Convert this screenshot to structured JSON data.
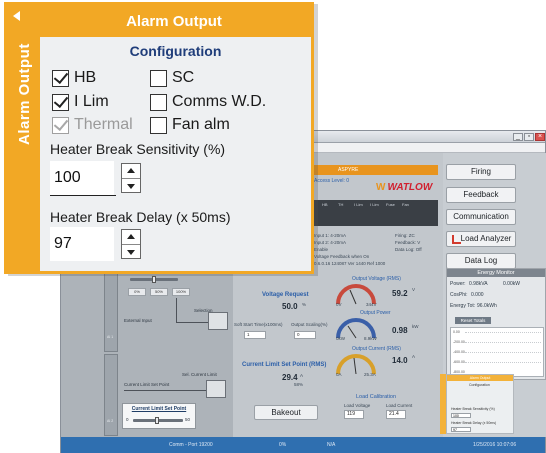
{
  "background_app": {
    "status_bar": {
      "left": "Comm - Port 19200",
      "mid1": "0%",
      "mid2": "N/A",
      "right": "1/25/2016 10:07:06"
    },
    "aspyre": {
      "header": "ASPYRE",
      "access_level": "Access Level: 0",
      "logo": "WATLOW",
      "logo_mark": "W"
    },
    "darktable_headers": [
      "HB",
      "TH",
      "I Lim",
      "I Lim",
      "Fuse",
      "Fan"
    ],
    "info_lines": [
      "Input 1: 4-20mA",
      "Input 2: 4-20mA",
      "Enable",
      "Voltage Feedback when On",
      "0.6.0.16 124087 Ver 1440 Ref 1000"
    ],
    "info_right": [
      "Firing: ZC",
      "Feedback: V",
      "Data Log: Off"
    ],
    "right_buttons": {
      "firing": "Firing",
      "feedback": "Feedback",
      "communication": "Communication",
      "load_analyzer": "Load Analyzer",
      "data_log": "Data Log"
    },
    "energy": {
      "title": "Energy Monitor",
      "power_label": "Power:",
      "power_val": "0.98kVA",
      "power_val2": "0.00kW",
      "cosphi_label": "CosPhi:",
      "cosphi_val": "0.000",
      "energy_label": "Energy Tot:",
      "energy_val": "96.0kWh",
      "reset": "Reset Totals",
      "ticks": [
        "0.00",
        "-200.00",
        "-400.00",
        "-600.00",
        "-800.00"
      ]
    },
    "center": {
      "voltage_req_label": "Voltage Request",
      "voltage_req_val": "50.0",
      "voltage_req_unit": "%",
      "soft_start_label": "Soft Start Time(x100ms)",
      "soft_start_val": "1",
      "out_scaling_label": "Output Scaling(%)",
      "out_scaling_val": "0",
      "clsp_label": "Current Limit Set Point (RMS)",
      "clsp_val": "29.4",
      "clsp_unit": "A",
      "clsp_pct": "58%",
      "bakeout": "Bakeout"
    },
    "gauges": {
      "out_voltage_label": "Output Voltage (RMS)",
      "out_voltage_val": "59.2",
      "out_voltage_unit": "V",
      "out_power_label": "Output Power",
      "out_power_val": "0.98",
      "out_power_unit": "kW",
      "out_current_label": "Output Current (RMS)",
      "out_current_val": "14.0",
      "out_current_unit": "A",
      "v_min": "0V",
      "v_max": "344V",
      "p_min": "0kW",
      "p_max": "8.9kW",
      "c_min": "0A",
      "c_max": "25.3A"
    },
    "load_cal": {
      "title": "Load Calibration",
      "lv_label": "Load Voltage",
      "lc_label": "Load Current",
      "lv_val": "119",
      "lc_val": "21.4"
    },
    "left_diag": {
      "sel_values": [
        "0%",
        "50%",
        "100%"
      ],
      "external_input": "External Input",
      "selection": "Selection",
      "sel_current_limit": "Sel. Current Limit",
      "current_limit_set_point": "Current Limit Set Point",
      "clsp_panel_title": "Current Limit Set Point",
      "clsp_min": "0",
      "clsp_max": "50",
      "strip_labels": [
        "AI 1",
        "AI 2"
      ]
    },
    "mini_alarm": {
      "title": "Alarm Output",
      "config": "Configuration",
      "lbl1": "Heater Break Sensitivity (%)",
      "val1": "100",
      "lbl2": "Heater Break Delay (x 50ms)",
      "val2": "97"
    }
  },
  "popup": {
    "side_label": "Alarm Output",
    "title": "Alarm Output",
    "section": "Configuration",
    "checkboxes": [
      {
        "label": "HB",
        "checked": true,
        "disabled": false
      },
      {
        "label": "SC",
        "checked": false,
        "disabled": false
      },
      {
        "label": "I Lim",
        "checked": true,
        "disabled": false
      },
      {
        "label": "Comms W.D.",
        "checked": false,
        "disabled": false
      },
      {
        "label": "Thermal",
        "checked": true,
        "disabled": true
      },
      {
        "label": "Fan alm",
        "checked": false,
        "disabled": false
      }
    ],
    "hb_sensitivity_label": "Heater Break Sensitivity (%)",
    "hb_sensitivity_value": "100",
    "hb_delay_label": "Heater Break Delay (x 50ms)",
    "hb_delay_value": "97"
  },
  "colors": {
    "accent": "#f2a825",
    "config_text": "#1f3d7a",
    "status_bar": "#2f6fb0"
  }
}
